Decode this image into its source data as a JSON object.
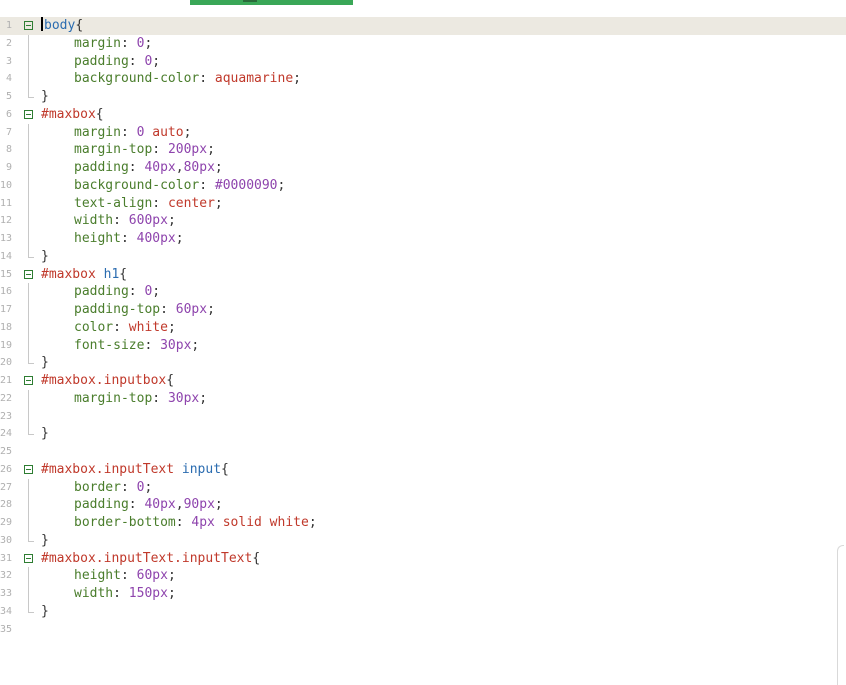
{
  "editor": {
    "lines": [
      {
        "no": "1",
        "fold": "open",
        "current": true,
        "caret": true,
        "tokens": [
          {
            "t": "b",
            "c": "tag"
          },
          {
            "t": "ody",
            "c": "tag"
          },
          {
            "t": "{",
            "c": "pn"
          }
        ]
      },
      {
        "no": "2",
        "guide": "mid",
        "indent": true,
        "tokens": [
          {
            "t": "margin",
            "c": "prop"
          },
          {
            "t": ": ",
            "c": "pn"
          },
          {
            "t": "0",
            "c": "num"
          },
          {
            "t": ";",
            "c": "pn"
          }
        ]
      },
      {
        "no": "3",
        "guide": "mid",
        "indent": true,
        "tokens": [
          {
            "t": "padding",
            "c": "prop"
          },
          {
            "t": ": ",
            "c": "pn"
          },
          {
            "t": "0",
            "c": "num"
          },
          {
            "t": ";",
            "c": "pn"
          }
        ]
      },
      {
        "no": "4",
        "guide": "mid",
        "indent": true,
        "tokens": [
          {
            "t": "background-color",
            "c": "prop"
          },
          {
            "t": ": ",
            "c": "pn"
          },
          {
            "t": "aquamarine",
            "c": "kw"
          },
          {
            "t": ";",
            "c": "pn"
          }
        ]
      },
      {
        "no": "5",
        "guide": "end",
        "tokens": [
          {
            "t": "}",
            "c": "pn"
          }
        ]
      },
      {
        "no": "6",
        "fold": "open",
        "tokens": [
          {
            "t": "#maxbox",
            "c": "sel"
          },
          {
            "t": "{",
            "c": "pn"
          }
        ]
      },
      {
        "no": "7",
        "guide": "mid",
        "indent": true,
        "tokens": [
          {
            "t": "margin",
            "c": "prop"
          },
          {
            "t": ": ",
            "c": "pn"
          },
          {
            "t": "0",
            "c": "num"
          },
          {
            "t": " ",
            "c": "pn"
          },
          {
            "t": "auto",
            "c": "kw"
          },
          {
            "t": ";",
            "c": "pn"
          }
        ]
      },
      {
        "no": "8",
        "guide": "mid",
        "indent": true,
        "tokens": [
          {
            "t": "margin-top",
            "c": "prop"
          },
          {
            "t": ": ",
            "c": "pn"
          },
          {
            "t": "200px",
            "c": "num"
          },
          {
            "t": ";",
            "c": "pn"
          }
        ]
      },
      {
        "no": "9",
        "guide": "mid",
        "indent": true,
        "tokens": [
          {
            "t": "padding",
            "c": "prop"
          },
          {
            "t": ": ",
            "c": "pn"
          },
          {
            "t": "40px",
            "c": "num"
          },
          {
            "t": ",",
            "c": "pn"
          },
          {
            "t": "80px",
            "c": "num"
          },
          {
            "t": ";",
            "c": "pn"
          }
        ]
      },
      {
        "no": "10",
        "guide": "mid",
        "indent": true,
        "tokens": [
          {
            "t": "background-color",
            "c": "prop"
          },
          {
            "t": ": ",
            "c": "pn"
          },
          {
            "t": "#0000090",
            "c": "num"
          },
          {
            "t": ";",
            "c": "pn"
          }
        ]
      },
      {
        "no": "11",
        "guide": "mid",
        "indent": true,
        "tokens": [
          {
            "t": "text-align",
            "c": "prop"
          },
          {
            "t": ": ",
            "c": "pn"
          },
          {
            "t": "center",
            "c": "kw"
          },
          {
            "t": ";",
            "c": "pn"
          }
        ]
      },
      {
        "no": "12",
        "guide": "mid",
        "indent": true,
        "tokens": [
          {
            "t": "width",
            "c": "prop"
          },
          {
            "t": ": ",
            "c": "pn"
          },
          {
            "t": "600px",
            "c": "num"
          },
          {
            "t": ";",
            "c": "pn"
          }
        ]
      },
      {
        "no": "13",
        "guide": "mid",
        "indent": true,
        "tokens": [
          {
            "t": "height",
            "c": "prop"
          },
          {
            "t": ": ",
            "c": "pn"
          },
          {
            "t": "400px",
            "c": "num"
          },
          {
            "t": ";",
            "c": "pn"
          }
        ]
      },
      {
        "no": "14",
        "guide": "end",
        "tokens": [
          {
            "t": "}",
            "c": "pn"
          }
        ]
      },
      {
        "no": "15",
        "fold": "open",
        "tokens": [
          {
            "t": "#maxbox",
            "c": "sel"
          },
          {
            "t": " ",
            "c": "pn"
          },
          {
            "t": "h1",
            "c": "tag"
          },
          {
            "t": "{",
            "c": "pn"
          }
        ]
      },
      {
        "no": "16",
        "guide": "mid",
        "indent": true,
        "tokens": [
          {
            "t": "padding",
            "c": "prop"
          },
          {
            "t": ": ",
            "c": "pn"
          },
          {
            "t": "0",
            "c": "num"
          },
          {
            "t": ";",
            "c": "pn"
          }
        ]
      },
      {
        "no": "17",
        "guide": "mid",
        "indent": true,
        "tokens": [
          {
            "t": "padding-top",
            "c": "prop"
          },
          {
            "t": ": ",
            "c": "pn"
          },
          {
            "t": "60px",
            "c": "num"
          },
          {
            "t": ";",
            "c": "pn"
          }
        ]
      },
      {
        "no": "18",
        "guide": "mid",
        "indent": true,
        "tokens": [
          {
            "t": "color",
            "c": "prop"
          },
          {
            "t": ": ",
            "c": "pn"
          },
          {
            "t": "white",
            "c": "kw"
          },
          {
            "t": ";",
            "c": "pn"
          }
        ]
      },
      {
        "no": "19",
        "guide": "mid",
        "indent": true,
        "tokens": [
          {
            "t": "font-size",
            "c": "prop"
          },
          {
            "t": ": ",
            "c": "pn"
          },
          {
            "t": "30px",
            "c": "num"
          },
          {
            "t": ";",
            "c": "pn"
          }
        ]
      },
      {
        "no": "20",
        "guide": "end",
        "tokens": [
          {
            "t": "}",
            "c": "pn"
          }
        ]
      },
      {
        "no": "21",
        "fold": "open",
        "tokens": [
          {
            "t": "#maxbox.inputbox",
            "c": "sel"
          },
          {
            "t": "{",
            "c": "pn"
          }
        ]
      },
      {
        "no": "22",
        "guide": "mid",
        "indent": true,
        "tokens": [
          {
            "t": "margin-top",
            "c": "prop"
          },
          {
            "t": ": ",
            "c": "pn"
          },
          {
            "t": "30px",
            "c": "num"
          },
          {
            "t": ";",
            "c": "pn"
          }
        ]
      },
      {
        "no": "23",
        "guide": "mid",
        "tokens": []
      },
      {
        "no": "24",
        "guide": "end",
        "tokens": [
          {
            "t": "}",
            "c": "pn"
          }
        ]
      },
      {
        "no": "25",
        "tokens": []
      },
      {
        "no": "26",
        "fold": "open",
        "tokens": [
          {
            "t": "#maxbox.inputText",
            "c": "sel"
          },
          {
            "t": " ",
            "c": "pn"
          },
          {
            "t": "input",
            "c": "tag"
          },
          {
            "t": "{",
            "c": "pn"
          }
        ]
      },
      {
        "no": "27",
        "guide": "mid",
        "indent": true,
        "tokens": [
          {
            "t": "border",
            "c": "prop"
          },
          {
            "t": ": ",
            "c": "pn"
          },
          {
            "t": "0",
            "c": "num"
          },
          {
            "t": ";",
            "c": "pn"
          }
        ]
      },
      {
        "no": "28",
        "guide": "mid",
        "indent": true,
        "tokens": [
          {
            "t": "padding",
            "c": "prop"
          },
          {
            "t": ": ",
            "c": "pn"
          },
          {
            "t": "40px",
            "c": "num"
          },
          {
            "t": ",",
            "c": "pn"
          },
          {
            "t": "90px",
            "c": "num"
          },
          {
            "t": ";",
            "c": "pn"
          }
        ]
      },
      {
        "no": "29",
        "guide": "mid",
        "indent": true,
        "tokens": [
          {
            "t": "border-bottom",
            "c": "prop"
          },
          {
            "t": ": ",
            "c": "pn"
          },
          {
            "t": "4px",
            "c": "num"
          },
          {
            "t": " ",
            "c": "pn"
          },
          {
            "t": "solid white",
            "c": "kw"
          },
          {
            "t": ";",
            "c": "pn"
          }
        ]
      },
      {
        "no": "30",
        "guide": "end",
        "tokens": [
          {
            "t": "}",
            "c": "pn"
          }
        ]
      },
      {
        "no": "31",
        "fold": "open",
        "tokens": [
          {
            "t": "#maxbox.inputText.inputText",
            "c": "sel"
          },
          {
            "t": "{",
            "c": "pn"
          }
        ]
      },
      {
        "no": "32",
        "guide": "mid",
        "indent": true,
        "tokens": [
          {
            "t": "height",
            "c": "prop"
          },
          {
            "t": ": ",
            "c": "pn"
          },
          {
            "t": "60px",
            "c": "num"
          },
          {
            "t": ";",
            "c": "pn"
          }
        ]
      },
      {
        "no": "33",
        "guide": "mid",
        "indent": true,
        "tokens": [
          {
            "t": "width",
            "c": "prop"
          },
          {
            "t": ": ",
            "c": "pn"
          },
          {
            "t": "150px",
            "c": "num"
          },
          {
            "t": ";",
            "c": "pn"
          }
        ]
      },
      {
        "no": "34",
        "guide": "end",
        "tokens": [
          {
            "t": "}",
            "c": "pn"
          }
        ]
      },
      {
        "no": "35",
        "tokens": []
      }
    ]
  }
}
